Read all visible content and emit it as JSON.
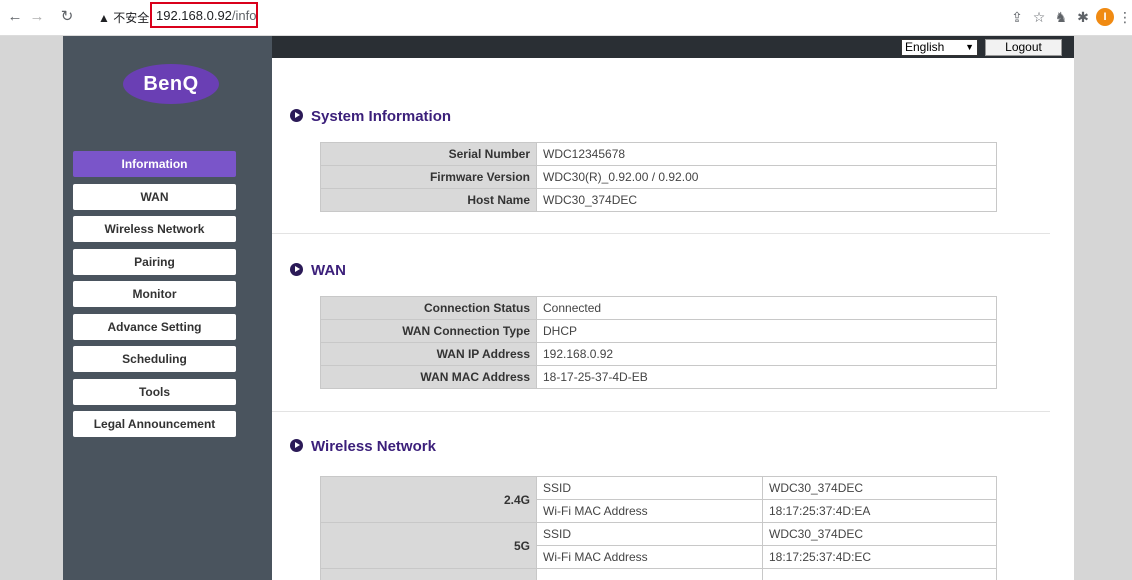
{
  "browser": {
    "warning": "▲ 不安全",
    "url_host": "192.168.0.92",
    "url_path": "/info"
  },
  "brand": {
    "logo_text": "BenQ",
    "accent": "#7a55c9",
    "sidebar_bg": "#4a545e"
  },
  "topbar": {
    "language": "English",
    "logout_label": "Logout"
  },
  "sidebar": {
    "items": [
      {
        "label": "Information",
        "active": true
      },
      {
        "label": "WAN"
      },
      {
        "label": "Wireless Network"
      },
      {
        "label": "Pairing"
      },
      {
        "label": "Monitor"
      },
      {
        "label": "Advance Setting"
      },
      {
        "label": "Scheduling"
      },
      {
        "label": "Tools"
      },
      {
        "label": "Legal Announcement"
      }
    ]
  },
  "system": {
    "title": "System Information",
    "rows": [
      {
        "label": "Serial Number",
        "value": "WDC12345678"
      },
      {
        "label": "Firmware Version",
        "value": "WDC30(R)_0.92.00 / 0.92.00"
      },
      {
        "label": "Host Name",
        "value": "WDC30_374DEC"
      }
    ]
  },
  "wan": {
    "title": "WAN",
    "rows": [
      {
        "label": "Connection Status",
        "value": "Connected"
      },
      {
        "label": "WAN Connection Type",
        "value": "DHCP"
      },
      {
        "label": "WAN IP Address",
        "value": "192.168.0.92"
      },
      {
        "label": "WAN MAC Address",
        "value": "18-17-25-37-4D-EB"
      }
    ]
  },
  "wireless": {
    "title": "Wireless Network",
    "bands": [
      {
        "band": "2.4G",
        "ssid_label": "SSID",
        "ssid": "WDC30_374DEC",
        "mac_label": "Wi-Fi MAC Address",
        "mac": "18:17:25:37:4D:EA"
      },
      {
        "band": "5G",
        "ssid_label": "SSID",
        "ssid": "WDC30_374DEC",
        "mac_label": "Wi-Fi MAC Address",
        "mac": "18:17:25:37:4D:EC"
      }
    ]
  }
}
